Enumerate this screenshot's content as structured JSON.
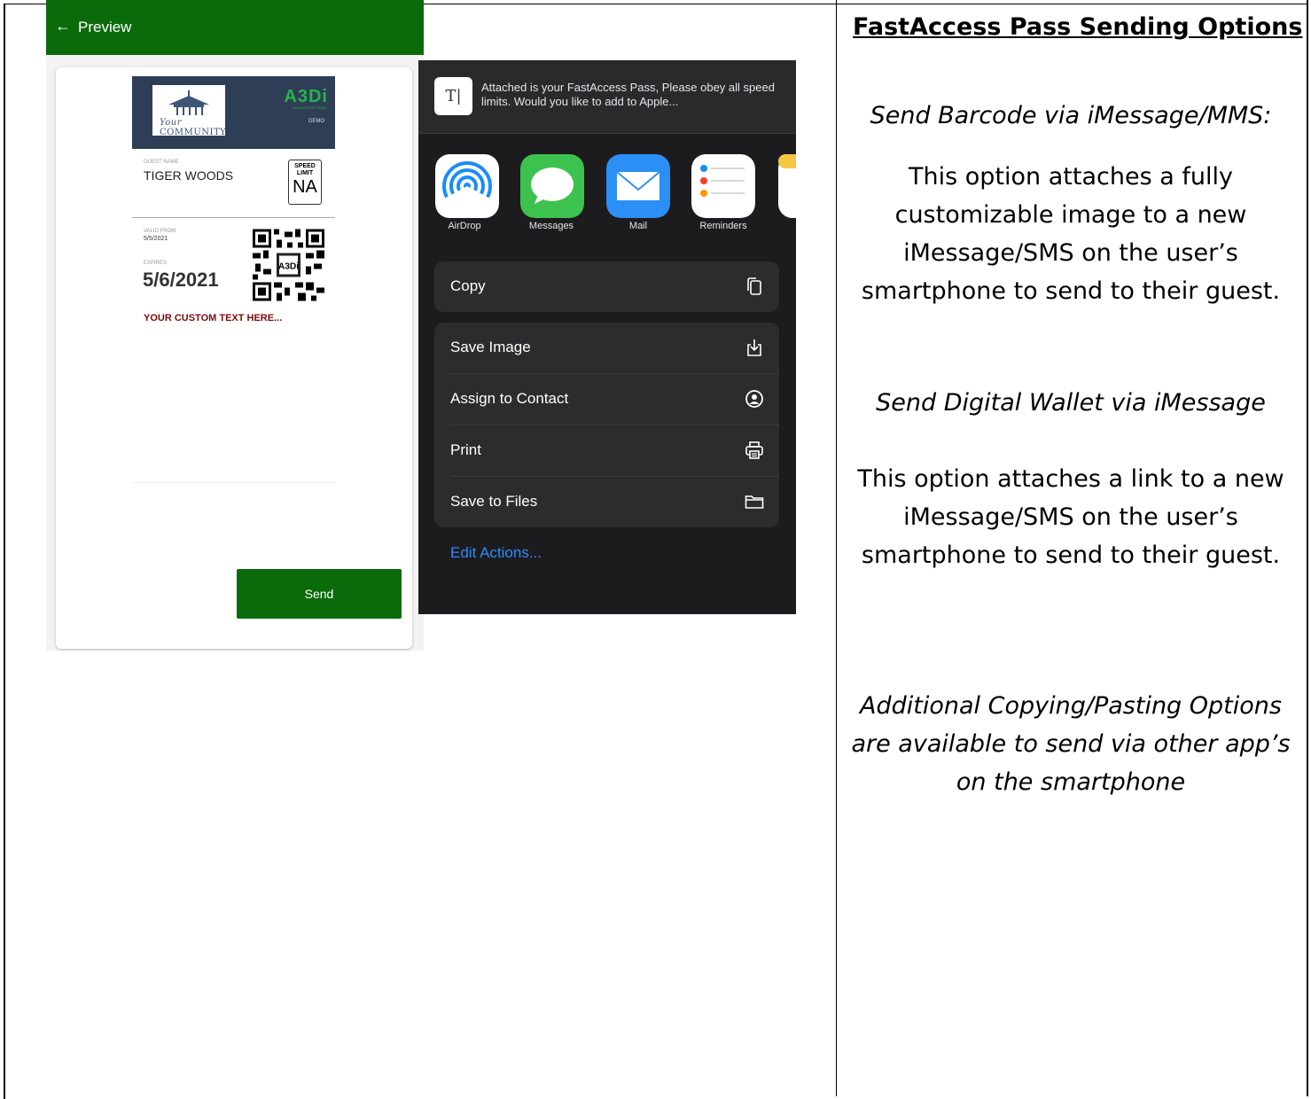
{
  "app": {
    "back_icon": "←",
    "title": "Preview",
    "send_label": "Send",
    "brand_color": "#0b6b0b"
  },
  "pass": {
    "logo_line1": "Your",
    "logo_line2": "COMMUNITY",
    "brand": "A3Di",
    "brand_sub": "FASTACCESS PASS",
    "demo": "DEMO",
    "guest_label": "GUEST NAME",
    "guest_name": "TIGER WOODS",
    "speed_label_1": "SPEED",
    "speed_label_2": "LIMIT",
    "speed_value": "NA",
    "valid_label": "VALID FROM",
    "valid_from": "5/5/2021",
    "expires_label": "EXPIRES",
    "expires": "5/6/2021",
    "custom_text": "YOUR CUSTOM TEXT HERE..."
  },
  "share_sheet": {
    "text_icon": "T|",
    "message": "Attached is your FastAccess Pass, Please obey all speed limits. Would you like to add to Apple...",
    "apps": [
      {
        "label": "AirDrop",
        "icon": "airdrop-icon",
        "color": "#1a8df5"
      },
      {
        "label": "Messages",
        "icon": "messages-icon",
        "color": "#3ec24f"
      },
      {
        "label": "Mail",
        "icon": "mail-icon",
        "color": "#2b8ff5"
      },
      {
        "label": "Reminders",
        "icon": "reminders-icon",
        "color": "#ffffff"
      }
    ],
    "actions": {
      "copy": "Copy",
      "save_image": "Save Image",
      "assign_contact": "Assign to Contact",
      "print": "Print",
      "save_files": "Save to Files",
      "edit_actions": "Edit Actions..."
    }
  },
  "doc": {
    "heading": "FastAccess Pass Sending Options",
    "section1_title": "Send Barcode via iMessage/MMS:",
    "section1_lines": [
      "This option attaches a fully",
      "customizable image to a new",
      "iMessage/SMS on the user’s",
      "smartphone to send to their guest."
    ],
    "section2_title": "Send Digital Wallet via iMessage",
    "section2_lines": [
      "This option attaches a link to a new",
      "iMessage/SMS on the user’s",
      "smartphone to send to their guest."
    ],
    "section3_lines": [
      "Additional Copying/Pasting Options",
      "are available to send via other app’s",
      "on the smartphone"
    ]
  }
}
